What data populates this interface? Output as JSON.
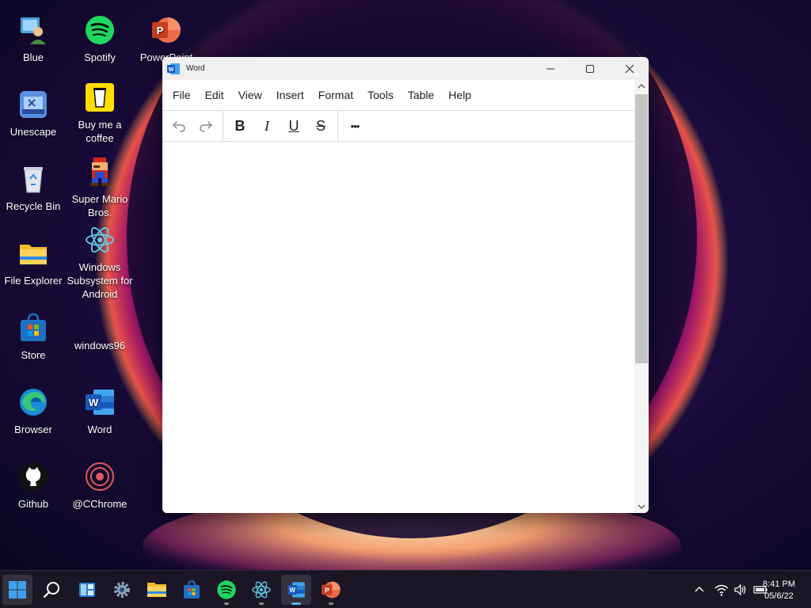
{
  "desktop": {
    "icons": [
      {
        "label": "Blue"
      },
      {
        "label": "Spotify"
      },
      {
        "label": "PowerPoint"
      },
      {
        "label": "Unescape"
      },
      {
        "label": "Buy me a coffee"
      },
      {
        "label": "Recycle Bin"
      },
      {
        "label": "Super Mario Bros."
      },
      {
        "label": "File Explorer"
      },
      {
        "label": "Windows Subsystem for Android"
      },
      {
        "label": "Store"
      },
      {
        "label": "windows96"
      },
      {
        "label": "Browser"
      },
      {
        "label": "Word"
      },
      {
        "label": "Github"
      },
      {
        "label": "@CChrome"
      }
    ]
  },
  "window": {
    "title": "Word",
    "menu": [
      "File",
      "Edit",
      "View",
      "Insert",
      "Format",
      "Tools",
      "Table",
      "Help"
    ],
    "toolbar": {
      "undo_icon": "undo-icon",
      "redo_icon": "redo-icon",
      "bold": "B",
      "italic": "I",
      "underline": "U",
      "strike": "S",
      "more": "•••"
    },
    "document_text": ""
  },
  "taskbar": {
    "apps": [
      "start",
      "search",
      "widgets",
      "settings",
      "file-explorer",
      "store",
      "spotify",
      "android-subsystem",
      "word",
      "powerpoint"
    ],
    "active_app": "word",
    "clock": {
      "time": "8:41 PM",
      "date": "05/6/22"
    }
  },
  "colors": {
    "accent": "#5fb4f2",
    "word_blue": "#2b5797",
    "spotify_green": "#1ed760",
    "powerpoint_orange": "#d24726"
  }
}
